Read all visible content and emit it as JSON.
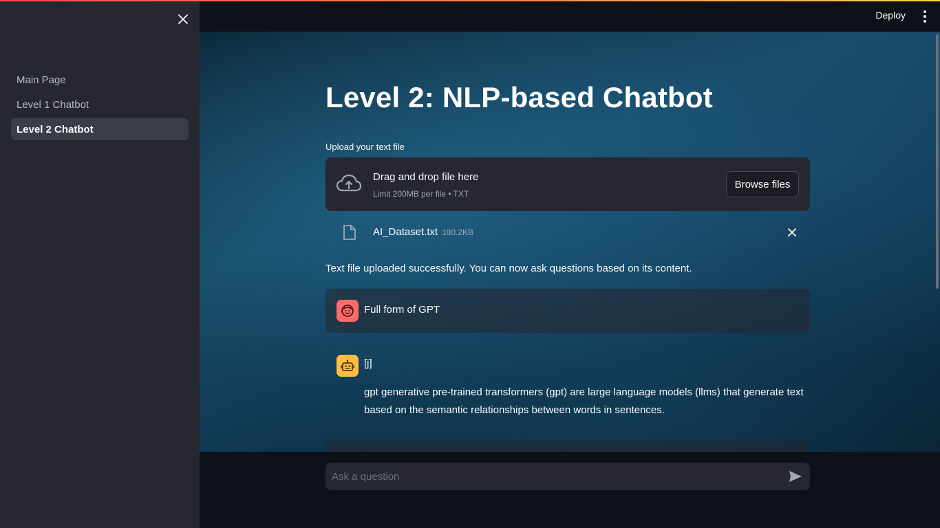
{
  "sidebar": {
    "items": [
      {
        "label": "Main Page",
        "active": false
      },
      {
        "label": "Level 1 Chatbot",
        "active": false
      },
      {
        "label": "Level 2 Chatbot",
        "active": true
      }
    ]
  },
  "header": {
    "deploy_label": "Deploy"
  },
  "main": {
    "title": "Level 2: NLP-based Chatbot",
    "upload": {
      "label": "Upload your text file",
      "drop_title": "Drag and drop file here",
      "drop_subtitle": "Limit 200MB per file • TXT",
      "browse_label": "Browse files"
    },
    "file": {
      "name": "AI_Dataset.txt",
      "size": "180.2KB"
    },
    "success_text": "Text file uploaded successfully. You can now ask questions based on its content.",
    "messages": [
      {
        "role": "user",
        "text": "Full form of GPT"
      },
      {
        "role": "assistant",
        "header": "[j]",
        "text": "gpt generative pre-trained transformers (gpt) are large language models (llms) that generate text based on the semantic relationships between words in sentences."
      }
    ]
  },
  "chat_input": {
    "placeholder": "Ask a question"
  },
  "colors": {
    "accent": "#ff4b4b",
    "user_avatar": "#ff6b6b",
    "bot_avatar": "#ffbd45",
    "sidebar_bg": "#262730"
  }
}
